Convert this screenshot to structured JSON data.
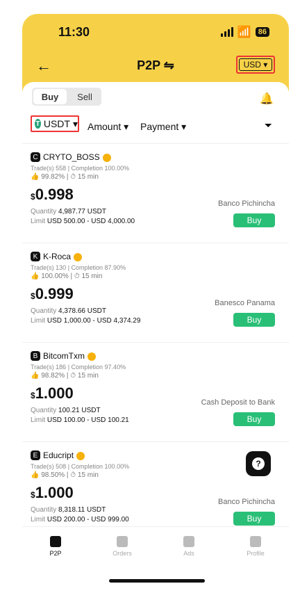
{
  "status": {
    "time": "11:30",
    "battery": "86"
  },
  "header": {
    "back": "←",
    "title": "P2P ⇋",
    "currency": "USD ▾"
  },
  "toggle": {
    "buy": "Buy",
    "sell": "Sell"
  },
  "filters": {
    "asset": "USDT",
    "amount": "Amount",
    "payment": "Payment"
  },
  "offers": [
    {
      "avatar": "C",
      "name": "CRYTO_BOSS",
      "stats": "Trade(s) 558 | Completion 100.00%",
      "stats2": "👍 99.82% | ⏱ 15 min",
      "price": "0.998",
      "qty": "4,987.77 USDT",
      "limit": "USD 500.00 - USD 4,000.00",
      "payment": "Banco Pichincha",
      "buy": "Buy"
    },
    {
      "avatar": "K",
      "name": "K-Roca",
      "stats": "Trade(s) 130 | Completion 87.90%",
      "stats2": "👍 100.00% | ⏱ 15 min",
      "price": "0.999",
      "qty": "4,378.66 USDT",
      "limit": "USD 1,000.00 - USD 4,374.29",
      "payment": "Banesco Panama",
      "buy": "Buy"
    },
    {
      "avatar": "B",
      "name": "BitcomTxm",
      "stats": "Trade(s) 186 | Completion 97.40%",
      "stats2": "👍 98.82% | ⏱ 15 min",
      "price": "1.000",
      "qty": "100.21 USDT",
      "limit": "USD 100.00 - USD 100.21",
      "payment": "Cash Deposit to Bank",
      "buy": "Buy"
    },
    {
      "avatar": "E",
      "name": "Educript",
      "stats": "Trade(s) 508 | Completion 100.00%",
      "stats2": "👍 98.50% | ⏱ 15 min",
      "price": "1.000",
      "qty": "8,318.11 USDT",
      "limit": "USD 200.00 - USD 999.00",
      "payment": "Banco Pichincha",
      "buy": "Buy"
    }
  ],
  "bottom_nav": [
    {
      "label": "P2P"
    },
    {
      "label": "Orders"
    },
    {
      "label": "Ads"
    },
    {
      "label": "Profile"
    }
  ]
}
